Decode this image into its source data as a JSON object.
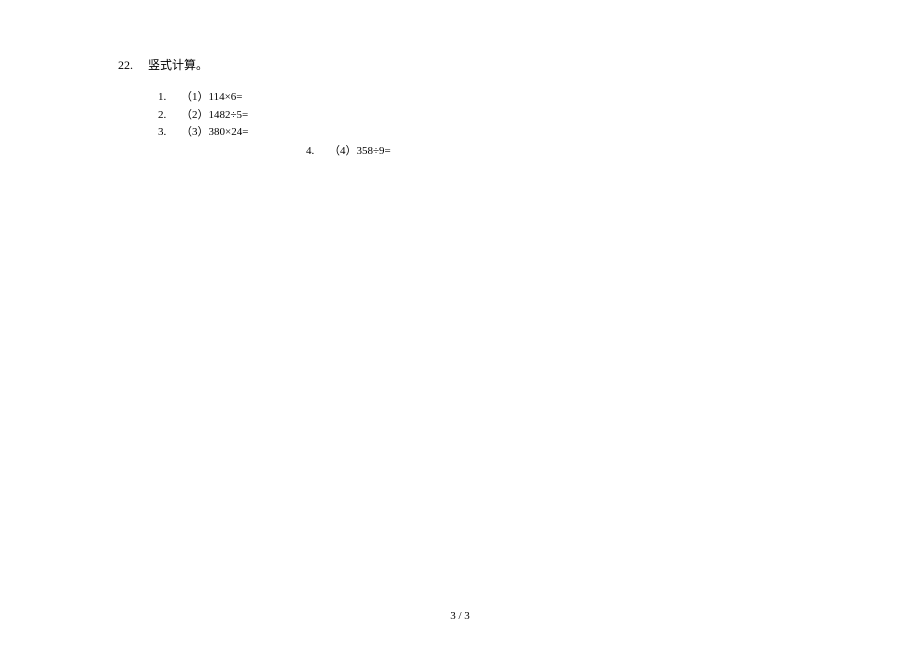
{
  "section": {
    "number": "22.",
    "title": "竖式计算。"
  },
  "items": [
    {
      "num": "1.",
      "text": "（1）114×6="
    },
    {
      "num": "2.",
      "text": "（2）1482÷5="
    },
    {
      "num": "3.",
      "text": "（3）380×24="
    },
    {
      "num": "4.",
      "text": "（4）358÷9="
    }
  ],
  "footer": {
    "page": "3 / 3"
  }
}
